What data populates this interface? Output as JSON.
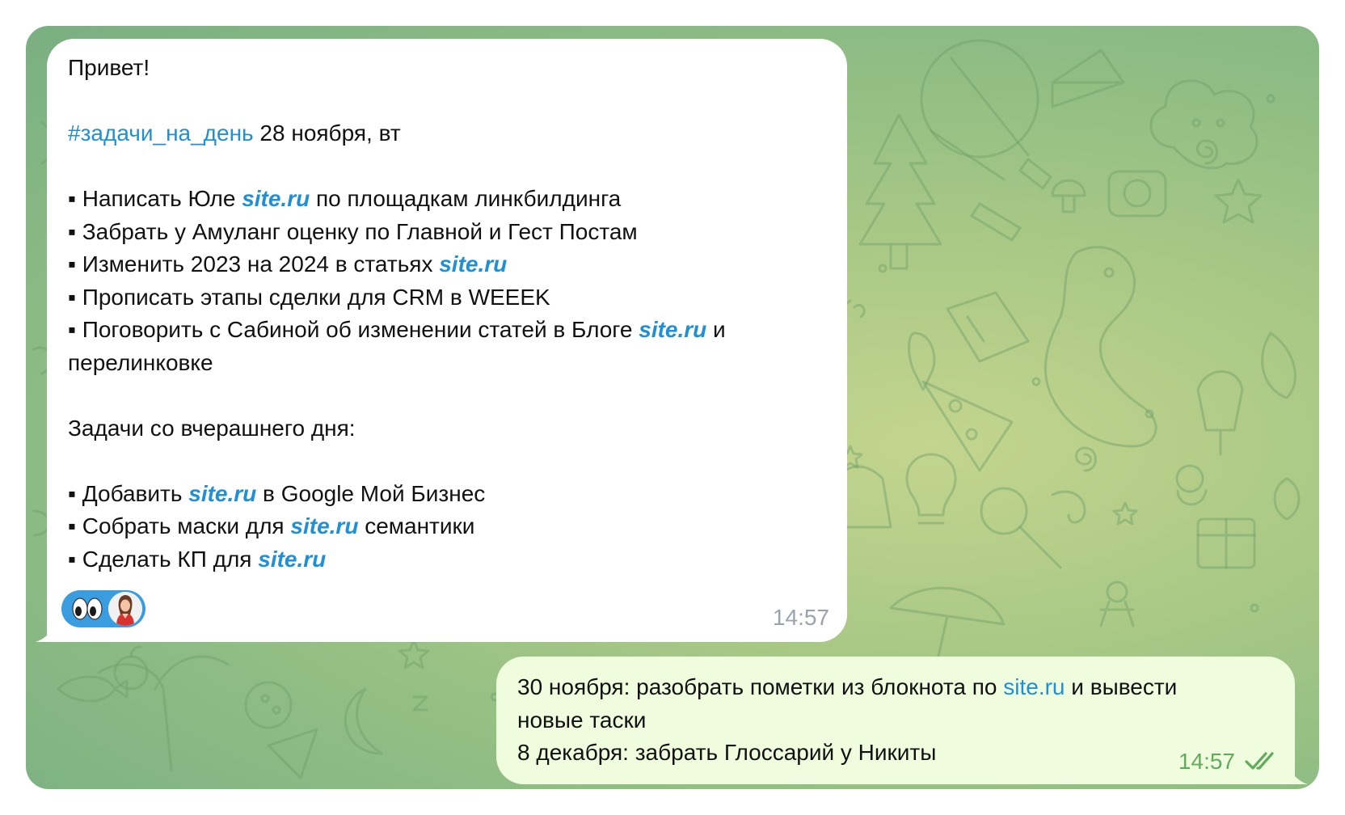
{
  "incoming_message": {
    "greeting": "Привет!",
    "hashtag": "#задачи_на_день",
    "date_text": " 28 ноября, вт",
    "task_list_today": [
      {
        "bullet": "▪",
        "before": " Написать Юле ",
        "link": "site.ru",
        "after": " по площадкам линкбилдинга"
      },
      {
        "bullet": "▪",
        "before": " Забрать у Амуланг оценку по Главной и Гест Постам",
        "link": "",
        "after": ""
      },
      {
        "bullet": "▪",
        "before": " Изменить 2023 на 2024 в статьях ",
        "link": "site.ru",
        "after": ""
      },
      {
        "bullet": "▪",
        "before": " Прописать этапы сделки для CRM в WEEEK",
        "link": "",
        "after": ""
      },
      {
        "bullet": "▪",
        "before": " Поговорить с Сабиной об изменении статей в Блоге ",
        "link": "site.ru",
        "after": " и"
      }
    ],
    "wrap_line": "перелинковке",
    "yesterday_heading": "Задачи со вчерашнего дня:",
    "task_list_yesterday": [
      {
        "bullet": "▪",
        "before": " Добавить ",
        "link": "site.ru",
        "after": " в Google Мой Бизнес"
      },
      {
        "bullet": "▪",
        "before": " Собрать маски для ",
        "link": "site.ru",
        "after": " семантики"
      },
      {
        "bullet": "▪",
        "before": " Сделать КП для ",
        "link": "site.ru",
        "after": ""
      }
    ],
    "reaction": {
      "emoji": "eyes-emoji",
      "avatar": "user-avatar"
    },
    "time": "14:57"
  },
  "outgoing_message": {
    "line1_before": "30 ноября: разобрать пометки из блокнота по ",
    "line1_link": "site.ru",
    "line1_after": " и вывести",
    "line2": "новые таски",
    "line3": "8 декабря: забрать Глоссарий у Никиты",
    "time": "14:57",
    "status_icon": "double-check-icon"
  },
  "colors": {
    "link": "#1f8fd6",
    "incoming_bubble": "#ffffff",
    "outgoing_bubble": "#effdde",
    "outgoing_time": "#62ab5d",
    "incoming_time": "#9aa3ab",
    "background": "#a9c886"
  }
}
